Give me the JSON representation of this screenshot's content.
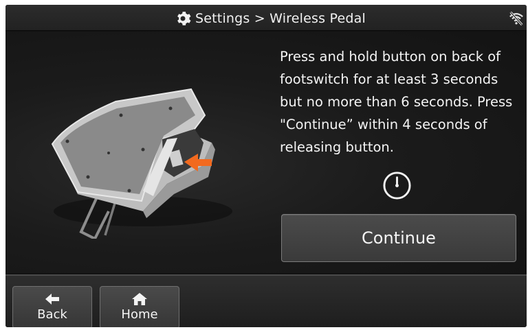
{
  "header": {
    "title": "Settings > Wireless Pedal",
    "settings_icon": "gear-icon",
    "status_icon": "wifi-off-icon"
  },
  "main": {
    "image_description": "wireless-footswitch-pedal",
    "instructions": "Press and hold button on back of footswitch for at least 3 seconds but no more than 6 seconds. Press \"Continue” within 4 seconds of releasing button.",
    "timer_icon": "clock-icon",
    "continue_label": "Continue"
  },
  "footer": {
    "back_label": "Back",
    "back_icon": "arrow-left-icon",
    "home_label": "Home",
    "home_icon": "home-icon"
  },
  "colors": {
    "background": "#121212",
    "highlight_arrow": "#f26a1f",
    "button_bg": "#404040",
    "text": "#f4f4f4"
  }
}
